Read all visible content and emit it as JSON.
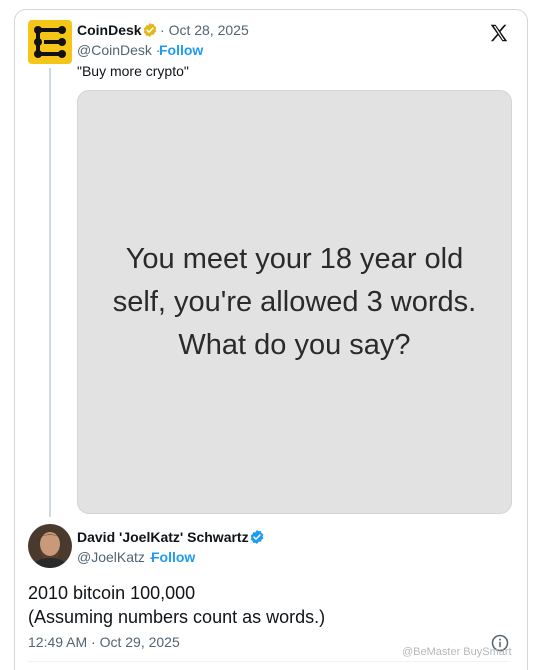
{
  "quoted_tweet": {
    "name": "CoinDesk",
    "date_separator": "·",
    "date": "Oct 28, 2025",
    "handle": "@CoinDesk",
    "follow": "Follow",
    "text": "\"Buy more crypto\"",
    "image_text_lines": [
      "You meet your 18 year old",
      "self, you're allowed 3 words.",
      "What do you say?"
    ]
  },
  "reply_tweet": {
    "name": "David 'JoelKatz' Schwartz",
    "handle": "@JoelKatz",
    "follow": "Follow",
    "text_line_1": "2010 bitcoin 100,000",
    "text_line_2": "(Assuming numbers count as words.)",
    "timestamp": "12:49 AM · Oct 29, 2025"
  },
  "watermark": "@BeMaster BuySmart",
  "icons": {
    "brand": "x-logo-icon",
    "verified": "verified-badge-icon",
    "info": "info-icon"
  },
  "colors": {
    "brand_yellow": "#f5c518",
    "link_blue": "#1d9bf0",
    "verified_gold": "#e2b719",
    "verified_blue": "#1d9bf0",
    "secondary_text": "#536471"
  }
}
